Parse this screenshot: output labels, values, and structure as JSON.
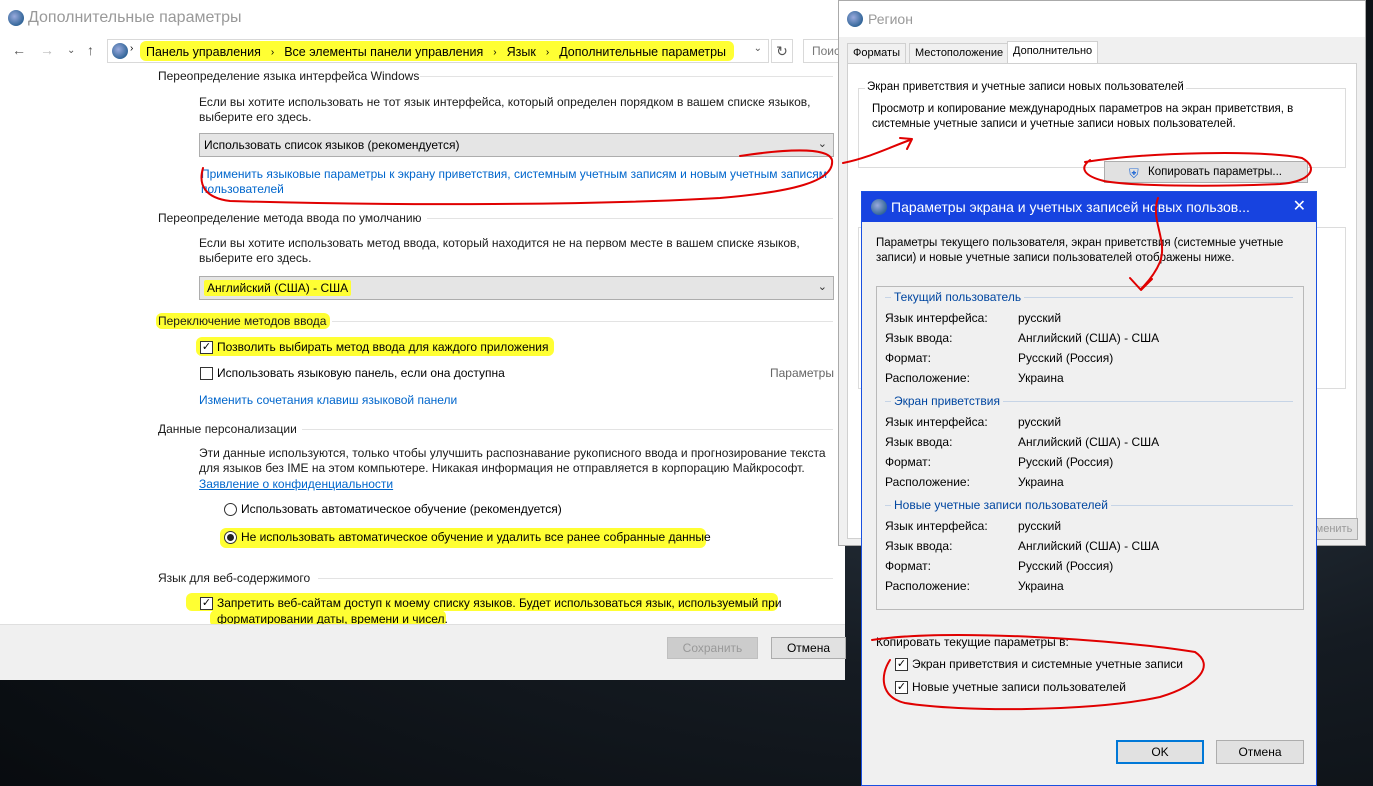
{
  "main": {
    "title": "Дополнительные параметры",
    "breadcrumb": [
      "Панель управления",
      "Все элементы панели управления",
      "Язык",
      "Дополнительные параметры"
    ],
    "search_placeholder": "Поиск",
    "sections": {
      "ui_lang_head": "Переопределение языка интерфейса Windows",
      "ui_lang_text": "Если вы хотите использовать не тот язык интерфейса, который определен порядком в вашем списке языков, выберите его здесь.",
      "ui_lang_combo": "Использовать список языков (рекомендуется)",
      "apply_link": "Применить языковые параметры к экрану приветствия, системным учетным записям и новым учетным записям пользователей",
      "input_head": "Переопределение метода ввода по умолчанию",
      "input_text": "Если вы хотите использовать метод ввода, который находится не на первом месте в вашем списке языков, выберите его здесь.",
      "input_combo": "Английский (США) - США",
      "switch_head": "Переключение методов ввода",
      "switch_cb1": "Позволить выбирать метод ввода для каждого приложения",
      "switch_cb2": "Использовать языковую панель, если она доступна",
      "switch_params": "Параметры",
      "switch_link": "Изменить сочетания клавиш языковой панели",
      "personal_head": "Данные персонализации",
      "personal_text": "Эти данные используются, только чтобы улучшить распознавание рукописного ввода и прогнозирование текста для языков без IME на этом компьютере. Никакая информация не отправляется в корпорацию Майкрософт.",
      "privacy_link": "Заявление о конфиденциальности",
      "radio1": "Использовать автоматическое обучение (рекомендуется)",
      "radio2": "Не использовать автоматическое обучение и удалить все ранее собранные данные",
      "web_head": "Язык для веб-содержимого",
      "web_cb_line1": "Запретить веб-сайтам доступ к моему списку языков. Будет использоваться язык, используемый при",
      "web_cb_line2": "форматировании даты, времени и чисел."
    },
    "save": "Сохранить",
    "cancel": "Отмена"
  },
  "region": {
    "title": "Регион",
    "tabs": [
      "Форматы",
      "Местоположение",
      "Дополнительно"
    ],
    "group_head": "Экран приветствия и учетные записи новых пользователей",
    "group_text": "Просмотр и копирование международных параметров на экран приветствия, в системные учетные записи и учетные записи новых пользователей.",
    "copy_button": "Копировать параметры...",
    "partial_button": "менить"
  },
  "dialog": {
    "title": "Параметры экрана и учетных записей новых пользов...",
    "intro": "Параметры текущего пользователя, экран приветствия (системные учетные записи) и новые учетные записи пользователей отображены ниже.",
    "groups": [
      {
        "title": "Текущий пользователь",
        "rows": [
          {
            "k": "Язык интерфейса:",
            "v": "русский"
          },
          {
            "k": "Язык ввода:",
            "v": "Английский (США) - США"
          },
          {
            "k": "Формат:",
            "v": "Русский (Россия)"
          },
          {
            "k": "Расположение:",
            "v": "Украина"
          }
        ]
      },
      {
        "title": "Экран приветствия",
        "rows": [
          {
            "k": "Язык интерфейса:",
            "v": "русский"
          },
          {
            "k": "Язык ввода:",
            "v": "Английский (США) - США"
          },
          {
            "k": "Формат:",
            "v": "Русский (Россия)"
          },
          {
            "k": "Расположение:",
            "v": "Украина"
          }
        ]
      },
      {
        "title": "Новые учетные записи пользователей",
        "rows": [
          {
            "k": "Язык интерфейса:",
            "v": "русский"
          },
          {
            "k": "Язык ввода:",
            "v": "Английский (США) - США"
          },
          {
            "k": "Формат:",
            "v": "Русский (Россия)"
          },
          {
            "k": "Расположение:",
            "v": "Украина"
          }
        ]
      }
    ],
    "copy_head": "Копировать текущие параметры в:",
    "copy_cb1": "Экран приветствия и системные учетные записи",
    "copy_cb2": "Новые учетные записи пользователей",
    "ok": "OK",
    "cancel": "Отмена"
  },
  "colors": {
    "highlight": "#ffff33",
    "annotation": "#e00000",
    "link": "#0066cc",
    "dialog_title": "#1743e0"
  }
}
